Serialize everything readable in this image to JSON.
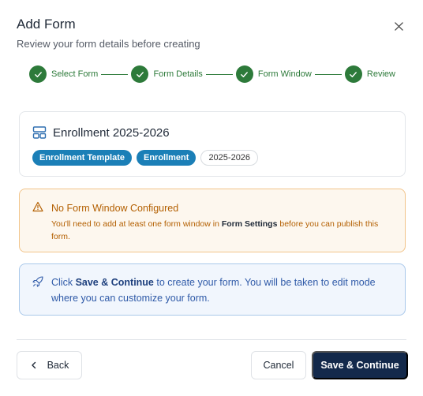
{
  "modal": {
    "title": "Add Form",
    "subtitle": "Review your form details before creating"
  },
  "stepper": {
    "steps": [
      {
        "label": "Select Form",
        "status": "complete"
      },
      {
        "label": "Form Details",
        "status": "complete"
      },
      {
        "label": "Form Window",
        "status": "complete"
      },
      {
        "label": "Review",
        "status": "complete"
      }
    ],
    "color": "#2d7a3a"
  },
  "form_card": {
    "icon": "layout-template-icon",
    "title": "Enrollment 2025-2026",
    "badges": [
      "Enrollment Template",
      "Enrollment",
      "2025-2026"
    ]
  },
  "warning": {
    "icon": "alert-triangle-icon",
    "title": "No Form Window Configured",
    "text_before": "You'll need to add at least one form window in ",
    "text_bold": "Form Settings",
    "text_after": " before you can publish this form."
  },
  "info": {
    "icon": "rocket-icon",
    "text_before": "Click ",
    "text_bold": "Save & Continue",
    "text_after": " to create your form. You will be taken to edit mode where you can customize your form."
  },
  "footer": {
    "back_label": "Back",
    "cancel_label": "Cancel",
    "save_label": "Save & Continue"
  },
  "colors": {
    "primary": "#13294b",
    "badge": "#1b7fb7",
    "warning": "#b35f00",
    "info": "#2f5aa8"
  }
}
